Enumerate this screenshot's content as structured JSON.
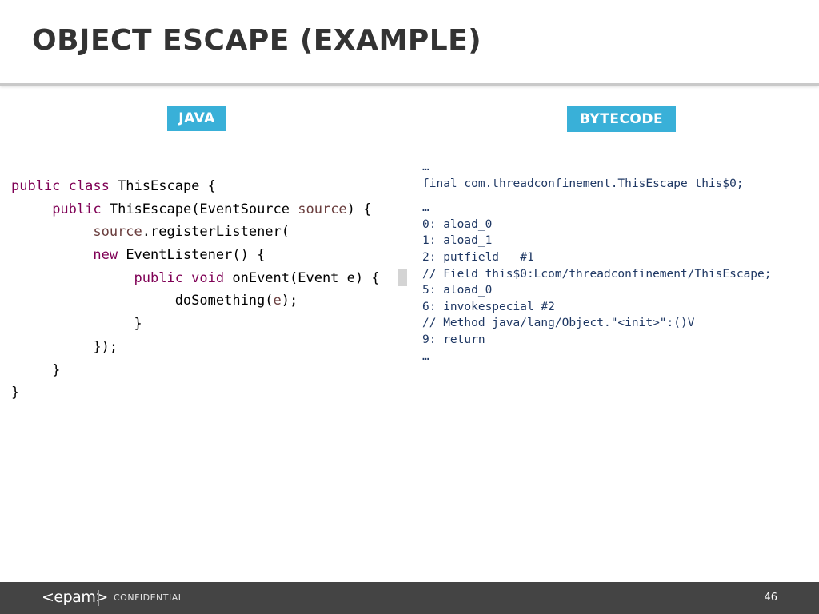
{
  "slide": {
    "title": "OBJECT ESCAPE (EXAMPLE)"
  },
  "java_panel": {
    "label": "JAVA",
    "lines": [
      [
        {
          "t": "public class ",
          "c": "kw"
        },
        {
          "t": "ThisEscape {",
          "c": "plain"
        }
      ],
      [
        {
          "t": "     ",
          "c": "plain"
        },
        {
          "t": "public ",
          "c": "kw"
        },
        {
          "t": "ThisEscape(EventSource ",
          "c": "plain"
        },
        {
          "t": "source",
          "c": "var"
        },
        {
          "t": ") {",
          "c": "plain"
        }
      ],
      [
        {
          "t": "          ",
          "c": "plain"
        },
        {
          "t": "source",
          "c": "var"
        },
        {
          "t": ".registerListener(",
          "c": "plain"
        }
      ],
      [
        {
          "t": "          ",
          "c": "plain"
        },
        {
          "t": "new ",
          "c": "kw"
        },
        {
          "t": "EventListener() {",
          "c": "plain"
        }
      ],
      [
        {
          "t": "               ",
          "c": "plain"
        },
        {
          "t": "public void ",
          "c": "kw"
        },
        {
          "t": "onEvent(Event e) {",
          "c": "plain"
        }
      ],
      [
        {
          "t": "                    doSomething(",
          "c": "plain"
        },
        {
          "t": "e",
          "c": "var"
        },
        {
          "t": ");",
          "c": "plain"
        }
      ],
      [
        {
          "t": "               }",
          "c": "plain"
        }
      ],
      [
        {
          "t": "          });",
          "c": "plain"
        }
      ],
      [
        {
          "t": "     }",
          "c": "plain"
        }
      ],
      [
        {
          "t": "}",
          "c": "plain"
        }
      ]
    ]
  },
  "bytecode_panel": {
    "label": "BYTECODE",
    "lines": [
      "…",
      "final com.threadconfinement.ThisEscape this$0;",
      "",
      "…",
      "0: aload_0",
      "1: aload_1",
      "2: putfield   #1",
      "// Field this$0:Lcom/threadconfinement/ThisEscape;",
      "5: aload_0",
      "6: invokespecial #2",
      "// Method java/lang/Object.\"<init>\":()V",
      "9: return",
      "…"
    ]
  },
  "footer": {
    "logo": "<epam>",
    "confidential": "CONFIDENTIAL",
    "page_number": "46"
  },
  "colors": {
    "tag_background": "#39b0d8",
    "java_keyword": "#7f0055",
    "java_variable": "#6a3e3e",
    "bytecode_text": "#1f3864",
    "footer_background": "#444444"
  }
}
